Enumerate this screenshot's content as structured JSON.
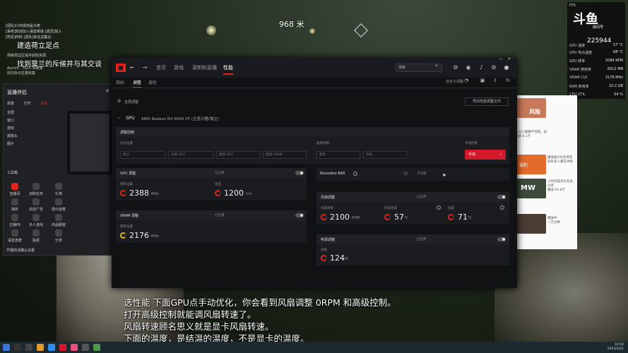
{
  "game": {
    "distance": "968 米",
    "marker_label": "?",
    "overlay_lines": [
      "[团队]小何说他是大佬",
      "[系统]欢迎加入语音频道 [成员]加入",
      "[附近]你好 [团队]来这边集合",
      "[系统]已连接到服务器 [附近]路过",
      "Acrow 的猫 [团队]好的"
    ],
    "quest_title": "建造荷立足点",
    "quest_subtitle": "找到莫兰的斥候并与其交谈",
    "quest_details": [
      "探索周边区域并获取资源",
      "Aschin · 7625 米距离",
      "前往标记位置收集"
    ]
  },
  "fps_overlay": {
    "logo_text": "斗鱼",
    "logo_sub": "房间号",
    "room_number": "225944",
    "rows": [
      {
        "k": "FPS",
        "v": ""
      },
      {
        "k": "GPU 温度",
        "v": "57 °C"
      },
      {
        "k": "GPU 热点温度",
        "v": "68 °C"
      },
      {
        "k": "GPU 频率",
        "v": "2089 RPM"
      },
      {
        "k": "VRAM 使用率",
        "v": "6512 MB"
      },
      {
        "k": "VRAM CLK",
        "v": "2176 MHz"
      },
      {
        "k": "RAM 使用率",
        "v": "10.2 GB"
      },
      {
        "k": "CPU UTIL",
        "v": "54 %"
      }
    ]
  },
  "tool": {
    "brand": "直播伴侣",
    "close": "✕",
    "tabs": [
      "场景",
      "打开",
      "设置"
    ],
    "list_items": [
      "全屏",
      "窗口",
      "游戏",
      "摄像头",
      "图片"
    ],
    "tools_label": "工具箱",
    "tools": [
      "直播间",
      "加购任务",
      "礼物",
      "抽奖",
      "动态广告",
      "观众连麦",
      "主播PK",
      "多人连线",
      "商品橱窗",
      "语音连麦",
      "贴纸",
      "分享"
    ],
    "footer": "开播前请确认设置"
  },
  "browser": {
    "items": [
      {
        "title": "风险",
        "line1": "东北人都赚不到钱，说",
        "line2": "播放 8.1万"
      },
      {
        "title": "福利",
        "line1": "播放超200多周年",
        "line2": "有好多人都在冲刺"
      },
      {
        "title": "MW",
        "line1": "小时内容对比有关分享",
        "line2": "播放 16.8万"
      },
      {
        "title": "",
        "line1": "播放中",
        "line2": "一万分钟"
      }
    ]
  },
  "amd": {
    "nav": [
      "首页",
      "游戏",
      "录制和直播",
      "性能"
    ],
    "search_placeholder": "搜索",
    "subnav": [
      "指标",
      "调整",
      "调优"
    ],
    "active_subnav": "调整",
    "right_sub": "自定义调整",
    "export_btn": "导出性能调整文件",
    "global_label": "全局调整",
    "gpu_label": "GPU",
    "gpu_name": "AMD Radeon RX 6650 XT (主显示器/独立)",
    "tuning_control": {
      "title": "调整控制",
      "left_label": "优化设置",
      "left_options": [
        "默认",
        "功耗 GPU",
        "超频 GPU",
        "超频 VRAM"
      ],
      "mid_label": "超频控制",
      "mid_options": [
        "超频",
        "功耗"
      ],
      "right_label": "手动控制",
      "manual_btn": "手动",
      "check": "✓"
    },
    "gpu_tuning": {
      "title": "GPU 调整",
      "status": "已启用",
      "freq_label": "频率设置",
      "freq_value": "2388",
      "freq_unit": "MHz",
      "volt_label": "电压",
      "volt_value": "1200",
      "volt_unit": "mV"
    },
    "vram_tuning": {
      "title": "VRAM 调整",
      "status": "已启用",
      "freq_label": "频率设置",
      "freq_value": "2176",
      "freq_unit": "MHz"
    },
    "resizable_bar": {
      "title": "Resizable BAR",
      "status": "不可用"
    },
    "fan_tuning": {
      "title": "风扇调整",
      "status": "已启用",
      "speed_label": "风扇转速",
      "speed_value": "2100",
      "speed_unit": "RPM",
      "fan_temp_label": "结温温度",
      "fan_temp_value": "57",
      "fan_temp_unit": "°C",
      "temp_label": "温度",
      "temp_value": "71",
      "temp_unit": "°C"
    },
    "power_tuning": {
      "title": "电源调整",
      "status": "已启用",
      "power_label": "功耗",
      "power_value": "124",
      "power_unit": "W"
    }
  },
  "subtitles": [
    "选性能  下面GPU点手动优化，你会看到风扇调整 0RPM 和高级控制。",
    "打开高级控制就能调风扇转速了。",
    "风扇转速顾名思义就是显卡风扇转速。",
    "下面的温度，是结温的温度，不是显卡的温度。"
  ],
  "taskbar": {
    "time": "16:16",
    "date": "2023/3/21"
  },
  "colors": {
    "amd_red": "#e2231a",
    "accent_red": "#d4182a",
    "bg_panel": "#1b1c1f",
    "fan_gauge": "#e6b422"
  }
}
